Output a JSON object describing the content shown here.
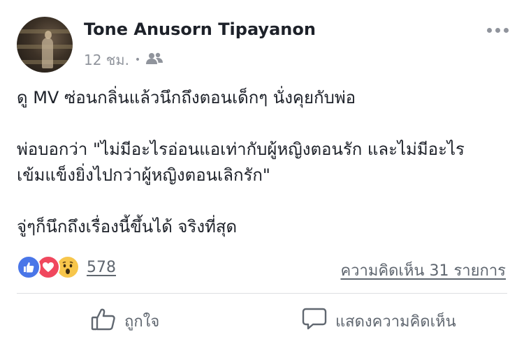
{
  "post": {
    "author": "Tone Anusorn Tipayanon",
    "time": "12 ชม.",
    "lines": [
      "ดู MV ซ่อนกลิ่นแล้วนึกถึงตอนเด็กๆ นั่งคุยกับพ่อ",
      "",
      "พ่อบอกว่า \"ไม่มีอะไรอ่อนแอเท่ากับผู้หญิงตอนรัก และไม่มีอะไร",
      "เข้มแข็งยิ่งไปกว่าผู้หญิงตอนเลิกรัก\"",
      "",
      "จู่ๆก็นึกถึงเรื่องนี้ขึ้นได้ จริงที่สุด"
    ]
  },
  "reactions": {
    "count": "578",
    "icons": [
      "like-icon",
      "love-icon",
      "wow-icon"
    ],
    "colors": {
      "like": "#4a76e8",
      "love": "#f0485e",
      "wow": "#f7c64b"
    }
  },
  "comments_label": "ความคิดเห็น 31 รายการ",
  "actions": {
    "like_label": "ถูกใจ",
    "comment_label": "แสดงความคิดเห็น"
  }
}
